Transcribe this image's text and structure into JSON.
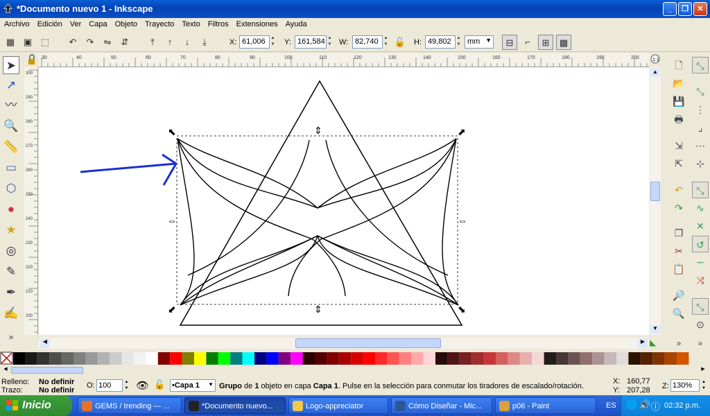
{
  "window": {
    "title": "*Documento nuevo 1 - Inkscape"
  },
  "menu": [
    "Archivo",
    "Edición",
    "Ver",
    "Capa",
    "Objeto",
    "Trayecto",
    "Texto",
    "Filtros",
    "Extensiones",
    "Ayuda"
  ],
  "toolbar": {
    "x_label": "X:",
    "x_value": "61,006",
    "y_label": "Y:",
    "y_value": "161,584",
    "w_label": "W:",
    "w_value": "82,740",
    "h_label": "H:",
    "h_value": "49,802",
    "unit": "mm"
  },
  "rulers": {
    "top": [
      "30",
      "40",
      "50",
      "60",
      "70",
      "80",
      "90",
      "100",
      "110",
      "120",
      "130",
      "140",
      "150",
      "160",
      "170",
      "180",
      "190",
      "200"
    ],
    "left": [
      "300",
      "290",
      "280",
      "270",
      "260",
      "250",
      "240",
      "230",
      "220",
      "210",
      "200"
    ]
  },
  "palette": [
    "#ffffff",
    "#000000",
    "#1a1a1a",
    "#333333",
    "#4d4d4d",
    "#666666",
    "#808080",
    "#999999",
    "#b3b3b3",
    "#cccccc",
    "#e6e6e6",
    "#f2f2f2",
    "#ffffff",
    "#800000",
    "#ff0000",
    "#808000",
    "#ffff00",
    "#008000",
    "#00ff00",
    "#008080",
    "#00ffff",
    "#000080",
    "#0000ff",
    "#800080",
    "#ff00ff",
    "#2b0000",
    "#550000",
    "#800000",
    "#aa0000",
    "#d40000",
    "#ff0000",
    "#ff2a2a",
    "#ff5555",
    "#ff8080",
    "#ffaaaa",
    "#ffd5d5",
    "#280b0b",
    "#501616",
    "#782121",
    "#a02c2c",
    "#c83737",
    "#d35f5f",
    "#de8787",
    "#e9afaf",
    "#f4d7d7",
    "#241c1c",
    "#483737",
    "#6c5353",
    "#916f6f",
    "#ac9393",
    "#c8b7b7",
    "#e3dbdb",
    "#2b1100",
    "#552200",
    "#803300",
    "#aa4400",
    "#d45500"
  ],
  "status": {
    "fill_label": "Relleno:",
    "fill_value": "No definir",
    "stroke_label": "Trazo:",
    "stroke_value": "No definir",
    "opacity_label": "O:",
    "opacity_value": "100",
    "layer": "•Capa 1",
    "message_bold1": "Grupo",
    "message_part1": " de ",
    "message_bold2": "1",
    "message_part2": " objeto en capa ",
    "message_bold3": "Capa 1",
    "message_part3": ". Pulse en la selección para conmutar los tiradores de escalado/rotación.",
    "cursor_x_label": "X:",
    "cursor_x": "160,77",
    "cursor_y_label": "Y:",
    "cursor_y": "207,28",
    "zoom_label": "Z:",
    "zoom": "130%"
  },
  "taskbar": {
    "start": "Inicio",
    "tasks": [
      {
        "label": "GEMS / trending — ...",
        "color": "#e8702a"
      },
      {
        "label": "*Documento nuevo...",
        "color": "#222222"
      },
      {
        "label": "Logo-appreciator",
        "color": "#f2c94c"
      },
      {
        "label": "Cómo Diseñar - Mic...",
        "color": "#2b5797"
      },
      {
        "label": "p06 - Paint",
        "color": "#d9a13b"
      }
    ],
    "lang": "ES",
    "clock": "02:32 p.m."
  }
}
